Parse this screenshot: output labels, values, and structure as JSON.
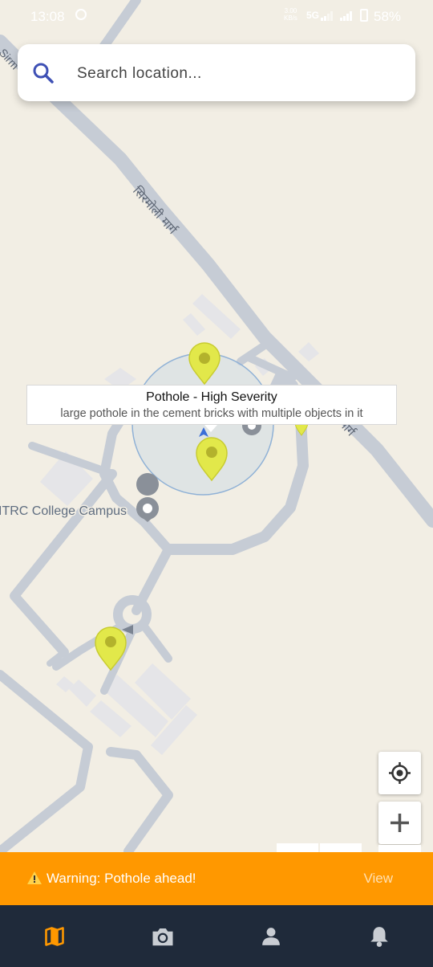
{
  "status_bar": {
    "time": "13:08",
    "net_speed": "3.00",
    "net_unit": "KB/s",
    "network": "5G",
    "battery": "58%"
  },
  "search": {
    "placeholder": "Search location...",
    "value": ""
  },
  "map": {
    "road_label_1": "सिरमोली मार्ग",
    "road_label_2": "मार्ग",
    "road_label_3": "Sirm",
    "place_label": "ITRC College Campus",
    "marker_color": "#e2e84a",
    "info_window": {
      "title": "Pothole - High Severity",
      "snippet": "large pothole in the cement bricks with multiple objects in it"
    },
    "controls": {
      "locate_icon": "crosshair-icon",
      "zoom_in_icon": "plus-icon"
    }
  },
  "warning": {
    "icon": "warning-icon",
    "text": "Warning: Pothole ahead!",
    "action": "View",
    "color": "#ff9800"
  },
  "bottom_nav": {
    "background": "#1f2a3a",
    "active_color": "#ff9800",
    "items": [
      {
        "icon": "map-icon",
        "active": true
      },
      {
        "icon": "camera-icon",
        "active": false
      },
      {
        "icon": "person-icon",
        "active": false
      },
      {
        "icon": "bell-icon",
        "active": false
      }
    ]
  }
}
